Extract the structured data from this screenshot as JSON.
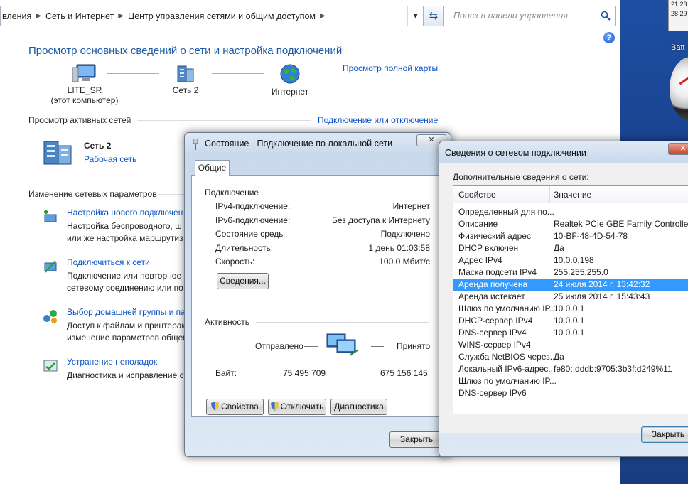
{
  "explorer": {
    "breadcrumb": [
      "вления",
      "Сеть и Интернет",
      "Центр управления сетями и общим доступом"
    ],
    "search_placeholder": "Поиск в панели управления",
    "help": "?",
    "title": "Просмотр основных сведений о сети и настройка подключений",
    "full_map_link": "Просмотр полной карты",
    "map": {
      "computer_name": "LITE_SR",
      "computer_note": "(этот компьютер)",
      "network_name": "Сеть  2",
      "internet": "Интернет"
    },
    "active_networks_title": "Просмотр активных сетей",
    "connect_disconnect_link": "Подключение или отключение",
    "active_network": {
      "name": "Сеть  2",
      "type": "Рабочая сеть"
    },
    "change_settings_title": "Изменение сетевых параметров",
    "tasks": [
      {
        "link": "Настройка нового подключен",
        "desc": [
          "Настройка беспроводного, ш",
          "или же настройка маршрутиз"
        ]
      },
      {
        "link": "Подключиться к сети",
        "desc": [
          "Подключение или повторное",
          "сетевому соединению или по"
        ]
      },
      {
        "link": "Выбор домашней группы и па",
        "desc": [
          "Доступ к файлам и принтерам",
          "изменение параметров общег"
        ]
      },
      {
        "link": "Устранение неполадок",
        "desc": [
          "Диагностика и исправление с"
        ]
      }
    ]
  },
  "desktop": {
    "calendar_lines": [
      "21  23",
      "28  29"
    ],
    "gadget_label": "Batt"
  },
  "status_dialog": {
    "title": "Состояние - Подключение по локальной сети",
    "close": "✕",
    "tab": "Общие",
    "connection_group": "Подключение",
    "rows": [
      {
        "label": "IPv4-подключение:",
        "value": "Интернет"
      },
      {
        "label": "IPv6-подключение:",
        "value": "Без доступа к Интернету"
      },
      {
        "label": "Состояние среды:",
        "value": "Подключено"
      },
      {
        "label": "Длительность:",
        "value": "1 день 01:03:58"
      },
      {
        "label": "Скорость:",
        "value": "100.0 Мбит/с"
      }
    ],
    "details_button": "Сведения...",
    "activity_group": "Активность",
    "sent_label": "Отправлено",
    "received_label": "Принято",
    "bytes_label": "Байт:",
    "bytes_sent": "75 495 709",
    "bytes_received": "675 156 145",
    "properties_button": "Свойства",
    "disable_button": "Отключить",
    "diagnose_button": "Диагностика",
    "close_button": "Закрыть"
  },
  "details_dialog": {
    "title": "Сведения о сетевом подключении",
    "close": "✕",
    "subtitle": "Дополнительные сведения о сети:",
    "col_property": "Свойство",
    "col_value": "Значение",
    "rows": [
      {
        "p": "Определенный для по...",
        "v": ""
      },
      {
        "p": "Описание",
        "v": "Realtek PCIe GBE Family Controller"
      },
      {
        "p": "Физический адрес",
        "v": "10-BF-48-4D-54-78"
      },
      {
        "p": "DHCP включен",
        "v": "Да"
      },
      {
        "p": "Адрес IPv4",
        "v": "10.0.0.198"
      },
      {
        "p": "Маска подсети IPv4",
        "v": "255.255.255.0"
      },
      {
        "p": "Аренда получена",
        "v": "24 июля 2014 г. 13:42:32",
        "selected": true
      },
      {
        "p": "Аренда истекает",
        "v": "25 июля 2014 г. 15:43:43"
      },
      {
        "p": "Шлюз по умолчанию IP...",
        "v": "10.0.0.1"
      },
      {
        "p": "DHCP-сервер IPv4",
        "v": "10.0.0.1"
      },
      {
        "p": "DNS-сервер IPv4",
        "v": "10.0.0.1"
      },
      {
        "p": "WINS-сервер IPv4",
        "v": ""
      },
      {
        "p": "Служба NetBIOS через...",
        "v": "Да"
      },
      {
        "p": "Локальный IPv6-адрес...",
        "v": "fe80::dddb:9705:3b3f:d249%11"
      },
      {
        "p": "Шлюз по умолчанию IP...",
        "v": ""
      },
      {
        "p": "DNS-сервер IPv6",
        "v": ""
      }
    ],
    "close_button": "Закрыть"
  },
  "colors": {
    "link": "#0b52c4",
    "title": "#1c5aa8",
    "selection": "#3399ff"
  }
}
